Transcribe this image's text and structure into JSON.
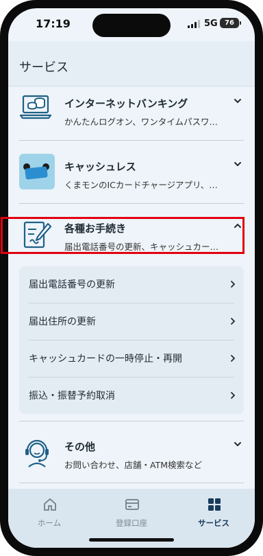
{
  "status_bar": {
    "time": "17:19",
    "network": "5G",
    "battery": "76"
  },
  "header": {
    "title": "サービス"
  },
  "services": [
    {
      "name": "インターネットバンキング",
      "desc": "かんたんログオン、ワンタイムパスワ…",
      "icon": "computer-coins-icon",
      "expanded": false
    },
    {
      "name": "キャッシュレス",
      "desc": "くまモンのICカードチャージアプリ、…",
      "icon": "cashless-card-image",
      "expanded": false
    },
    {
      "name": "各種お手続き",
      "desc": "届出電話番号の更新、キャッシュカー…",
      "icon": "form-pen-icon",
      "expanded": true
    },
    {
      "name": "その他",
      "desc": "お問い合わせ、店舗・ATM検索など",
      "icon": "headset-icon",
      "expanded": false
    }
  ],
  "procedures": [
    {
      "label": "届出電話番号の更新",
      "highlighted": false
    },
    {
      "label": "届出住所の更新",
      "highlighted": true
    },
    {
      "label": "キャッシュカードの一時停止・再開",
      "highlighted": false
    },
    {
      "label": "振込・振替予約取消",
      "highlighted": false
    }
  ],
  "tabs": [
    {
      "label": "ホーム",
      "icon": "home-icon",
      "active": false
    },
    {
      "label": "登録口座",
      "icon": "account-card-icon",
      "active": false
    },
    {
      "label": "サービス",
      "icon": "grid-icon",
      "active": true
    }
  ],
  "colors": {
    "accent": "#173b5c",
    "highlight": "#e2000f",
    "background": "#eef4f9"
  }
}
